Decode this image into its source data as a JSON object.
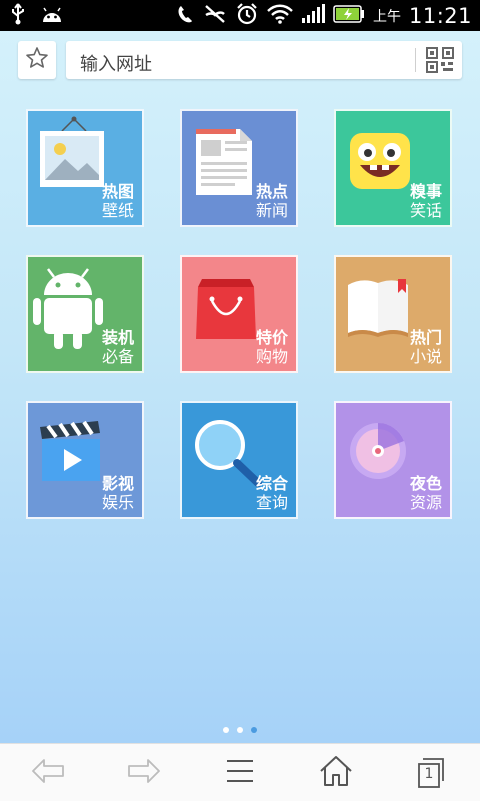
{
  "status_bar": {
    "am_pm": "上午",
    "time": "11:21",
    "icons": [
      "usb-icon",
      "android-icon",
      "mute-icon",
      "missed-call-icon",
      "alarm-icon",
      "wifi-icon",
      "signal-icon",
      "battery-icon"
    ]
  },
  "address_bar": {
    "placeholder": "输入网址",
    "icons": [
      "star-icon",
      "qr-code-icon"
    ]
  },
  "tiles": [
    {
      "line1": "热图",
      "line2": "壁纸",
      "color": "#5aafe3",
      "icon": "picture-frame-icon"
    },
    {
      "line1": "热点",
      "line2": "新闻",
      "color": "#6a8fd4",
      "icon": "newspaper-icon"
    },
    {
      "line1": "糗事",
      "line2": "笑话",
      "color": "#3cc79b",
      "icon": "laughing-face-icon"
    },
    {
      "line1": "装机",
      "line2": "必备",
      "color": "#63b46a",
      "icon": "android-robot-icon"
    },
    {
      "line1": "特价",
      "line2": "购物",
      "color": "#f3868a",
      "icon": "shopping-bag-icon"
    },
    {
      "line1": "热门",
      "line2": "小说",
      "color": "#ddaa6a",
      "icon": "open-book-icon"
    },
    {
      "line1": "影视",
      "line2": "娱乐",
      "color": "#6d98d8",
      "icon": "clapperboard-icon"
    },
    {
      "line1": "综合",
      "line2": "查询",
      "color": "#3998d9",
      "icon": "magnifier-icon"
    },
    {
      "line1": "夜色",
      "line2": "资源",
      "color": "#b292e8",
      "icon": "radar-icon"
    }
  ],
  "pager": {
    "total": 3,
    "active": 3
  },
  "bottom_bar": {
    "icons": [
      "back-arrow-icon",
      "forward-arrow-icon",
      "menu-icon",
      "home-icon",
      "tabs-icon"
    ],
    "tab_count": "1"
  },
  "colors": {
    "accent": "#4b9be0"
  }
}
